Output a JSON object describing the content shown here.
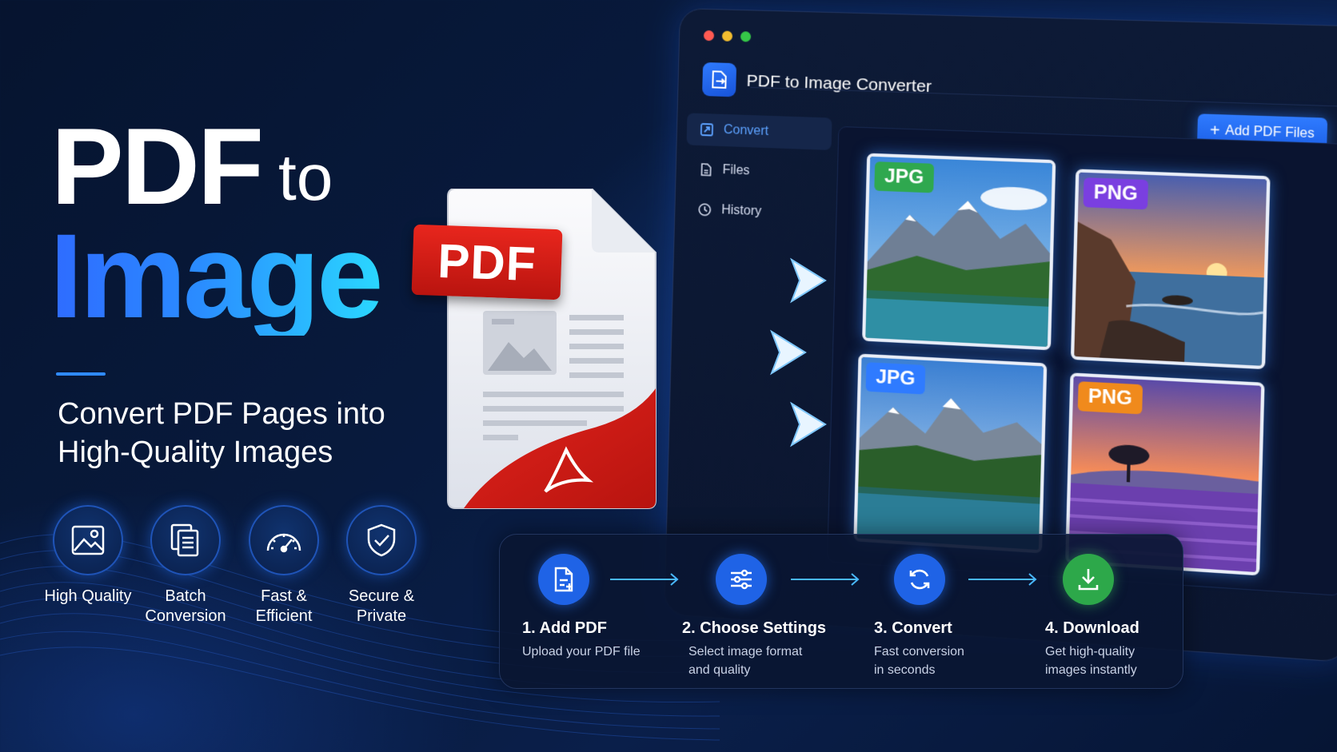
{
  "hero": {
    "line1": "PDF",
    "line1_suffix": "to",
    "line2": "Image",
    "subtitle": "Convert PDF Pages into High-Quality Images"
  },
  "features": [
    {
      "icon": "image-icon",
      "label": "High Quality"
    },
    {
      "icon": "documents-icon",
      "label": "Batch\nConversion"
    },
    {
      "icon": "speedometer-icon",
      "label": "Fast &\nEfficient"
    },
    {
      "icon": "shield-check-icon",
      "label": "Secure &\nPrivate"
    }
  ],
  "pdf_badge": "PDF",
  "app": {
    "title": "PDF to Image Converter",
    "add_button": "Add PDF Files",
    "nav": [
      {
        "icon": "convert-icon",
        "label": "Convert",
        "active": true
      },
      {
        "icon": "file-icon",
        "label": "Files",
        "active": false
      },
      {
        "icon": "clock-icon",
        "label": "History",
        "active": false
      }
    ],
    "images": [
      {
        "format": "JPG",
        "badge_color": "#2fa84f",
        "scene": "mountain-lake"
      },
      {
        "format": "PNG",
        "badge_color": "#7a3fe0",
        "scene": "sunset-coast"
      },
      {
        "format": "JPG",
        "badge_color": "#2f7bff",
        "scene": "mountain-lake"
      },
      {
        "format": "PNG",
        "badge_color": "#f08a1c",
        "scene": "lavender-sunset"
      }
    ]
  },
  "steps": [
    {
      "icon": "add-document-icon",
      "title": "1. Add PDF",
      "desc": "Upload your PDF file",
      "color": "#1f63e6"
    },
    {
      "icon": "sliders-icon",
      "title": "2. Choose Settings",
      "desc": "Select image format\nand quality",
      "color": "#1f63e6"
    },
    {
      "icon": "refresh-icon",
      "title": "3. Convert",
      "desc": "Fast conversion\nin seconds",
      "color": "#1f63e6"
    },
    {
      "icon": "download-icon",
      "title": "4. Download",
      "desc": "Get high-quality\nimages instantly",
      "color": "#2da84a"
    }
  ]
}
